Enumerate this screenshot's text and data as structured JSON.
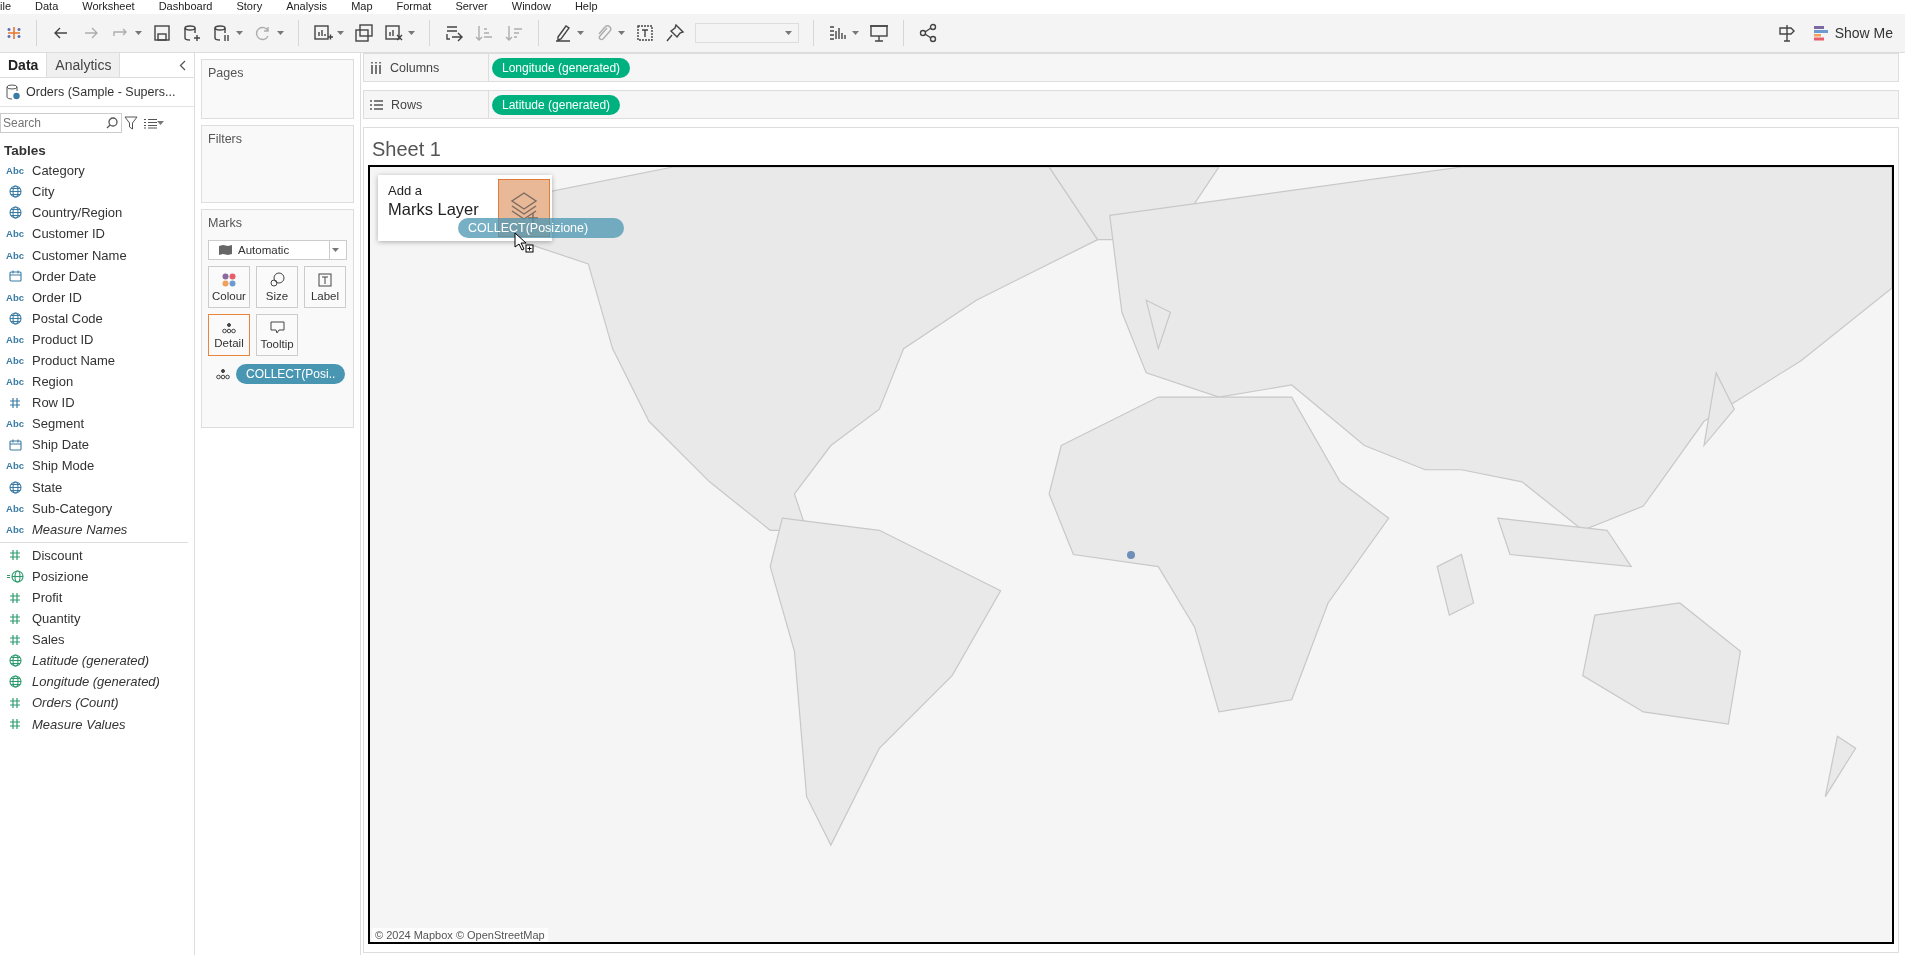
{
  "menu": [
    "ile",
    "Data",
    "Worksheet",
    "Dashboard",
    "Story",
    "Analysis",
    "Map",
    "Format",
    "Server",
    "Window",
    "Help"
  ],
  "toolbar": {
    "show_me": "Show Me"
  },
  "data_pane": {
    "tabs": [
      {
        "label": "Data",
        "selected": true
      },
      {
        "label": "Analytics",
        "selected": false
      }
    ],
    "datasource": "Orders (Sample - Supers...",
    "search": {
      "placeholder": "Search"
    },
    "heading": "Tables",
    "fields": [
      {
        "name": "Category",
        "kind": "string",
        "badge": "Abc",
        "measure": false,
        "generated": false
      },
      {
        "name": "City",
        "kind": "geo",
        "measure": false,
        "generated": false
      },
      {
        "name": "Country/Region",
        "kind": "geo",
        "measure": false,
        "generated": false
      },
      {
        "name": "Customer ID",
        "kind": "string",
        "badge": "Abc",
        "measure": false,
        "generated": false
      },
      {
        "name": "Customer Name",
        "kind": "string",
        "badge": "Abc",
        "measure": false,
        "generated": false
      },
      {
        "name": "Order Date",
        "kind": "date",
        "measure": false,
        "generated": false
      },
      {
        "name": "Order ID",
        "kind": "string",
        "badge": "Abc",
        "measure": false,
        "generated": false
      },
      {
        "name": "Postal Code",
        "kind": "geo",
        "measure": false,
        "generated": false
      },
      {
        "name": "Product ID",
        "kind": "string",
        "badge": "Abc",
        "measure": false,
        "generated": false
      },
      {
        "name": "Product Name",
        "kind": "string",
        "badge": "Abc",
        "measure": false,
        "generated": false
      },
      {
        "name": "Region",
        "kind": "string",
        "badge": "Abc",
        "measure": false,
        "generated": false
      },
      {
        "name": "Row ID",
        "kind": "number",
        "measure": false,
        "generated": false
      },
      {
        "name": "Segment",
        "kind": "string",
        "badge": "Abc",
        "measure": false,
        "generated": false
      },
      {
        "name": "Ship Date",
        "kind": "date",
        "measure": false,
        "generated": false
      },
      {
        "name": "Ship Mode",
        "kind": "string",
        "badge": "Abc",
        "measure": false,
        "generated": false
      },
      {
        "name": "State",
        "kind": "geo",
        "measure": false,
        "generated": false
      },
      {
        "name": "Sub-Category",
        "kind": "string",
        "badge": "Abc",
        "measure": false,
        "generated": false
      },
      {
        "name": "Measure Names",
        "kind": "string",
        "badge": "Abc",
        "measure": false,
        "generated": true
      },
      {
        "name": "Discount",
        "kind": "number",
        "measure": true,
        "generated": false
      },
      {
        "name": "Posizione",
        "kind": "geo-group",
        "measure": true,
        "generated": false
      },
      {
        "name": "Profit",
        "kind": "number",
        "measure": true,
        "generated": false
      },
      {
        "name": "Quantity",
        "kind": "number",
        "measure": true,
        "generated": false
      },
      {
        "name": "Sales",
        "kind": "number",
        "measure": true,
        "generated": false
      },
      {
        "name": "Latitude (generated)",
        "kind": "geo",
        "measure": true,
        "generated": true
      },
      {
        "name": "Longitude (generated)",
        "kind": "geo",
        "measure": true,
        "generated": true
      },
      {
        "name": "Orders (Count)",
        "kind": "number",
        "measure": true,
        "generated": true
      },
      {
        "name": "Measure Values",
        "kind": "number",
        "measure": true,
        "generated": true
      }
    ]
  },
  "cards": {
    "pages": "Pages",
    "filters": "Filters",
    "marks": {
      "title": "Marks",
      "mark_type": "Automatic",
      "buttons": [
        {
          "label": "Colour",
          "kind": "colour",
          "selected": false
        },
        {
          "label": "Size",
          "kind": "size",
          "selected": false
        },
        {
          "label": "Label",
          "kind": "label",
          "selected": false
        },
        {
          "label": "Detail",
          "kind": "detail",
          "selected": true
        },
        {
          "label": "Tooltip",
          "kind": "tooltip",
          "selected": false
        }
      ],
      "pills": [
        {
          "label": "COLLECT(Posi..",
          "kind": "detail",
          "continuous": false
        }
      ]
    }
  },
  "shelves": [
    {
      "label": "Columns",
      "kind": "columns",
      "pills": [
        {
          "label": "Longitude (generated)",
          "continuous": true
        }
      ]
    },
    {
      "label": "Rows",
      "kind": "rows",
      "pills": [
        {
          "label": "Latitude (generated)",
          "continuous": true
        }
      ]
    }
  ],
  "sheet": {
    "title": "Sheet 1",
    "map": {
      "overlay": {
        "line1": "Add a",
        "line2": "Marks Layer"
      },
      "dragged_pill": "COLLECT(Posizione)",
      "attribution": "© 2024 Mapbox © OpenStreetMap"
    }
  }
}
